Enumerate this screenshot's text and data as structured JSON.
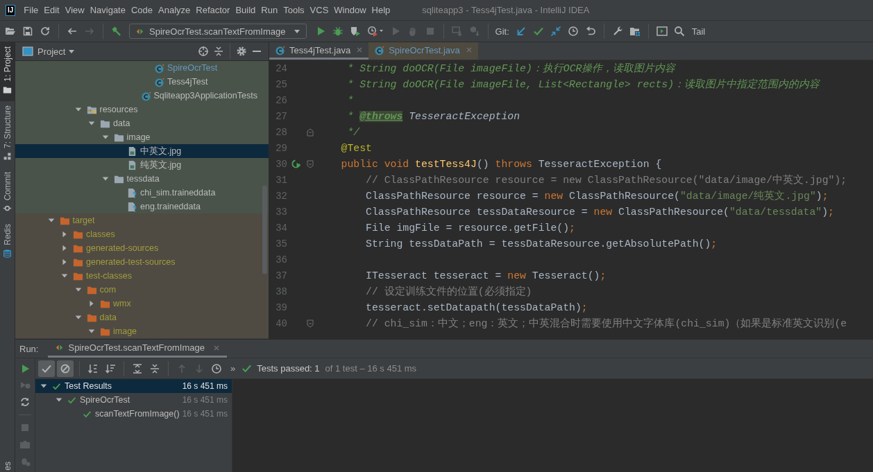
{
  "window": {
    "logo": "IJ",
    "title": "sqliteapp3 - Tess4jTest.java - IntelliJ IDEA"
  },
  "menu": [
    "File",
    "Edit",
    "View",
    "Navigate",
    "Code",
    "Analyze",
    "Refactor",
    "Build",
    "Run",
    "Tools",
    "VCS",
    "Window",
    "Help"
  ],
  "toolbar": [
    {
      "kind": "open-folder",
      "disabled": false
    },
    {
      "kind": "save",
      "disabled": false
    },
    {
      "kind": "sync",
      "disabled": false
    },
    {
      "kind": "separator"
    },
    {
      "kind": "back",
      "disabled": false
    },
    {
      "kind": "forward",
      "disabled": true
    },
    {
      "kind": "separator"
    },
    {
      "kind": "build",
      "disabled": false
    },
    {
      "kind": "run-config",
      "label": "SpireOcrTest.scanTextFromImage"
    },
    {
      "kind": "run",
      "disabled": false
    },
    {
      "kind": "debug",
      "disabled": false
    },
    {
      "kind": "coverage",
      "disabled": false
    },
    {
      "kind": "profile",
      "disabled": false
    },
    {
      "kind": "run",
      "disabled": true
    },
    {
      "kind": "attach",
      "disabled": true
    },
    {
      "kind": "stop",
      "disabled": true
    },
    {
      "kind": "separator"
    },
    {
      "kind": "monitor-down",
      "disabled": true
    },
    {
      "kind": "cubes-down",
      "disabled": true
    },
    {
      "kind": "separator"
    },
    {
      "kind": "label",
      "label": "Git:"
    },
    {
      "kind": "vcs-update",
      "disabled": false
    },
    {
      "kind": "vcs-commit",
      "disabled": false
    },
    {
      "kind": "vcs-push",
      "disabled": false
    },
    {
      "kind": "history",
      "disabled": false
    },
    {
      "kind": "rollback",
      "disabled": false
    },
    {
      "kind": "separator"
    },
    {
      "kind": "wrench",
      "disabled": false
    },
    {
      "kind": "structure",
      "disabled": false
    },
    {
      "kind": "separator"
    },
    {
      "kind": "terminal",
      "disabled": false
    },
    {
      "kind": "search",
      "disabled": false
    },
    {
      "kind": "text",
      "label": "Tail"
    }
  ],
  "left_stripe": [
    {
      "label": "1: Project",
      "kind": "project",
      "selected": true
    },
    {
      "label": "7: Structure",
      "kind": "structure-view",
      "selected": false
    },
    {
      "label": "Commit",
      "kind": "commit",
      "selected": false
    },
    {
      "label": "Redis",
      "kind": "redis",
      "selected": false
    }
  ],
  "bottom_stripe": {
    "label": "es"
  },
  "project_panel": {
    "title": "Project",
    "tree": [
      {
        "children": [
          {
            "children": [
              {
                "test_source": true,
                "children": [
                  {
                    "children": [
                      {
                        "children": [
                          {
                            "children": [
                              {
                                "children": [
                                  {
                                    "children": [
                                      {
                                        "label": "SpireOcrTest",
                                        "kind": "class",
                                        "modified": true,
                                        "selected": false
                                      },
                                      {
                                        "label": "Tess4jTest",
                                        "kind": "class",
                                        "modified": false,
                                        "selected": false
                                      }
                                    ]
                                  },
                                  {
                                    "label": "Sqliteapp3ApplicationTests",
                                    "kind": "class",
                                    "modified": false,
                                    "selected": false
                                  }
                                ]
                              }
                            ]
                          }
                        ]
                      }
                    ]
                  },
                  {
                    "label": "resources",
                    "kind": "resources",
                    "expanded": true,
                    "selected": false,
                    "children": [
                      {
                        "label": "data",
                        "kind": "folder",
                        "expanded": true,
                        "selected": false,
                        "children": [
                          {
                            "label": "image",
                            "kind": "folder",
                            "expanded": true,
                            "selected": false,
                            "children": [
                              {
                                "label": "中英文.jpg",
                                "kind": "image",
                                "selected": true
                              },
                              {
                                "label": "纯英文.jpg",
                                "kind": "image",
                                "selected": false
                              }
                            ]
                          },
                          {
                            "label": "tessdata",
                            "kind": "folder",
                            "expanded": true,
                            "selected": false,
                            "children": [
                              {
                                "label": "chi_sim.traineddata",
                                "kind": "data",
                                "selected": false
                              },
                              {
                                "label": "eng.traineddata",
                                "kind": "data",
                                "selected": false
                              }
                            ]
                          }
                        ]
                      }
                    ]
                  }
                ]
              }
            ]
          },
          {
            "label": "target",
            "kind": "folder",
            "excluded": true,
            "expanded": true,
            "selected": false,
            "children": [
              {
                "label": "classes",
                "kind": "folder",
                "expanded": false,
                "selected": false
              },
              {
                "label": "generated-sources",
                "kind": "folder",
                "expanded": false,
                "selected": false
              },
              {
                "label": "generated-test-sources",
                "kind": "folder",
                "expanded": false,
                "selected": false
              },
              {
                "label": "test-classes",
                "kind": "folder",
                "expanded": true,
                "selected": false,
                "children": [
                  {
                    "label": "com",
                    "kind": "folder",
                    "expanded": true,
                    "selected": false,
                    "children": [
                      {
                        "label": "wmx",
                        "kind": "folder",
                        "expanded": false,
                        "selected": false
                      }
                    ]
                  },
                  {
                    "label": "data",
                    "kind": "folder",
                    "expanded": true,
                    "selected": false,
                    "children": [
                      {
                        "label": "image",
                        "kind": "folder",
                        "expanded": true,
                        "selected": false
                      }
                    ]
                  }
                ]
              }
            ]
          }
        ]
      }
    ]
  },
  "editor": {
    "tabs": [
      {
        "label": "Tess4jTest.java",
        "modified": false,
        "selected": true
      },
      {
        "label": "SpireOcrTest.java",
        "modified": true,
        "selected": false
      }
    ],
    "lines": [
      {
        "number": "24",
        "segments": [
          {
            "kind": "doc",
            "text": "     * String doOCR(File imageFile)：执行OCR操作，读取图片内容"
          }
        ]
      },
      {
        "number": "25",
        "segments": [
          {
            "kind": "doc",
            "text": "     * String doOCR(File imageFile, List<Rectangle> rects)：读取图片中指定范围内的内容"
          }
        ]
      },
      {
        "number": "26",
        "segments": [
          {
            "kind": "doc",
            "text": "     *"
          }
        ]
      },
      {
        "number": "27",
        "segments": [
          {
            "kind": "doc",
            "text": "     * "
          },
          {
            "kind": "doctag",
            "text": "@throws"
          },
          {
            "kind": "docref",
            "text": " TesseractException"
          }
        ]
      },
      {
        "number": "28",
        "fold": {
          "kind": "end"
        },
        "segments": [
          {
            "kind": "doc",
            "text": "     */"
          }
        ]
      },
      {
        "number": "29",
        "segments": [
          {
            "kind": "annotation",
            "text": "    @Test"
          }
        ]
      },
      {
        "number": "30",
        "fold": {
          "kind": "start"
        },
        "run": true,
        "segments": [
          {
            "kind": "keyword",
            "text": "    public void "
          },
          {
            "kind": "method",
            "text": "testTess4J"
          },
          {
            "kind": "plain",
            "text": "() "
          },
          {
            "kind": "keyword",
            "text": "throws"
          },
          {
            "kind": "plain",
            "text": " TesseractException {"
          }
        ]
      },
      {
        "number": "31",
        "segments": [
          {
            "kind": "comment",
            "text": "        // ClassPathResource resource = new ClassPathResource(\"data/image/中英文.jpg\");"
          }
        ]
      },
      {
        "number": "32",
        "segments": [
          {
            "kind": "plain",
            "text": "        ClassPathResource resource = "
          },
          {
            "kind": "keyword",
            "text": "new"
          },
          {
            "kind": "plain",
            "text": " ClassPathResource("
          },
          {
            "kind": "string",
            "text": "\"data/image/纯英文.jpg\""
          },
          {
            "kind": "plain",
            "text": ")"
          },
          {
            "kind": "keyword",
            "text": ";"
          }
        ]
      },
      {
        "number": "33",
        "segments": [
          {
            "kind": "plain",
            "text": "        ClassPathResource tessDataResource = "
          },
          {
            "kind": "keyword",
            "text": "new"
          },
          {
            "kind": "plain",
            "text": " ClassPathResource("
          },
          {
            "kind": "string",
            "text": "\"data/tessdata\""
          },
          {
            "kind": "plain",
            "text": ")"
          },
          {
            "kind": "keyword",
            "text": ";"
          }
        ]
      },
      {
        "number": "34",
        "segments": [
          {
            "kind": "plain",
            "text": "        File imgFile = resource.getFile()"
          },
          {
            "kind": "keyword",
            "text": ";"
          }
        ]
      },
      {
        "number": "35",
        "segments": [
          {
            "kind": "plain",
            "text": "        String tessDataPath = tessDataResource.getAbsolutePath()"
          },
          {
            "kind": "keyword",
            "text": ";"
          }
        ]
      },
      {
        "number": "36"
      },
      {
        "number": "37",
        "segments": [
          {
            "kind": "plain",
            "text": "        ITesseract tesseract = "
          },
          {
            "kind": "keyword",
            "text": "new"
          },
          {
            "kind": "plain",
            "text": " Tesseract()"
          },
          {
            "kind": "keyword",
            "text": ";"
          }
        ]
      },
      {
        "number": "38",
        "segments": [
          {
            "kind": "comment",
            "text": "        // 设定训练文件的位置(必须指定)"
          }
        ]
      },
      {
        "number": "39",
        "segments": [
          {
            "kind": "plain",
            "text": "        tesseract.setDatapath(tessDataPath)"
          },
          {
            "kind": "keyword",
            "text": ";"
          }
        ]
      },
      {
        "number": "40",
        "fold": {
          "kind": "start"
        },
        "segments": [
          {
            "kind": "comment",
            "text": "        // chi_sim：中文；eng：英文；中英混合时需要使用中文字体库(chi_sim)（如果是标准英文识别(e"
          }
        ]
      }
    ]
  },
  "run_panel": {
    "label": "Run:",
    "tab": {
      "label": "SpireOcrTest.scanTextFromImage",
      "selected": true
    },
    "side_tools": [
      {
        "kind": "run",
        "disabled": false
      },
      {
        "kind": "rerun-failed",
        "disabled": true
      },
      {
        "kind": "auto-test",
        "disabled": false
      },
      {
        "kind": "separator"
      },
      {
        "kind": "stop",
        "disabled": true
      },
      {
        "kind": "camera",
        "disabled": true
      },
      {
        "kind": "settings-bug",
        "disabled": true
      }
    ],
    "tools": [
      {
        "kind": "show-passed",
        "on": true
      },
      {
        "kind": "show-ignored",
        "on": true
      },
      {
        "kind": "separator"
      },
      {
        "kind": "sort-alpha",
        "disabled": false
      },
      {
        "kind": "sort-duration",
        "disabled": false
      },
      {
        "kind": "separator"
      },
      {
        "kind": "expand-all",
        "disabled": false
      },
      {
        "kind": "collapse-all",
        "disabled": false
      },
      {
        "kind": "separator"
      },
      {
        "kind": "prev",
        "disabled": true
      },
      {
        "kind": "next",
        "disabled": true
      },
      {
        "kind": "history",
        "disabled": false
      },
      {
        "kind": "more",
        "label": "»"
      }
    ],
    "status": {
      "passed": "Tests passed: 1",
      "detail": "of 1 test – 16 s 451 ms"
    },
    "results": [
      {
        "label": "Test Results",
        "time": "16 s 451 ms",
        "passed": true,
        "selected": true,
        "expanded": true,
        "children": [
          {
            "label": "SpireOcrTest",
            "time": "16 s 451 ms",
            "passed": true,
            "selected": false,
            "expanded": true,
            "children": [
              {
                "label": "scanTextFromImage()",
                "time": "16 s 451 ms",
                "passed": true,
                "selected": false
              }
            ]
          }
        ]
      }
    ]
  }
}
